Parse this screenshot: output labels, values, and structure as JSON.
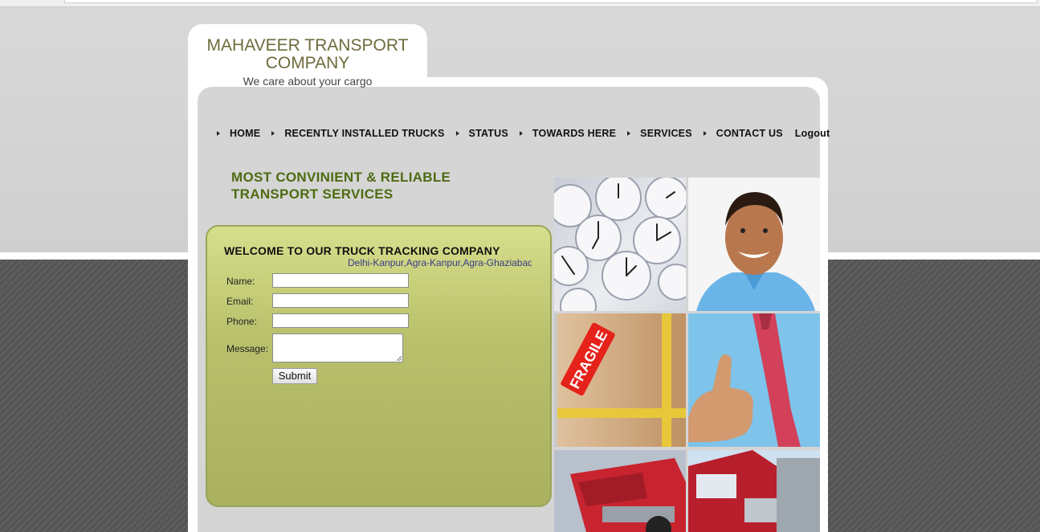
{
  "header": {
    "company_name": "MAHAVEER TRANSPORT COMPANY",
    "tagline": "We care about your cargo"
  },
  "nav": {
    "items": [
      {
        "label": "HOME"
      },
      {
        "label": "RECENTLY INSTALLED TRUCKS"
      },
      {
        "label": "STATUS"
      },
      {
        "label": "TOWARDS HERE"
      },
      {
        "label": "SERVICES"
      },
      {
        "label": "CONTACT US"
      }
    ],
    "logout_label": "Logout"
  },
  "headline": {
    "line1": "MOST CONVINIENT & RELIABLE",
    "line2": "TRANSPORT SERVICES"
  },
  "form": {
    "title": "WELCOME TO OUR TRUCK TRACKING COMPANY",
    "routes_ticker": "Delhi-Kanpur,Agra-Kanpur,Agra-Ghaziabad",
    "name_label": "Name:",
    "email_label": "Email:",
    "phone_label": "Phone:",
    "message_label": "Message:",
    "submit_label": "Submit"
  },
  "images": {
    "box_sticker_text": "FRAGILE"
  },
  "colors": {
    "headline": "#4e6b12",
    "logo": "#6e6b3c",
    "panel_top": "#d6df8c",
    "panel_bottom": "#a9b060"
  }
}
